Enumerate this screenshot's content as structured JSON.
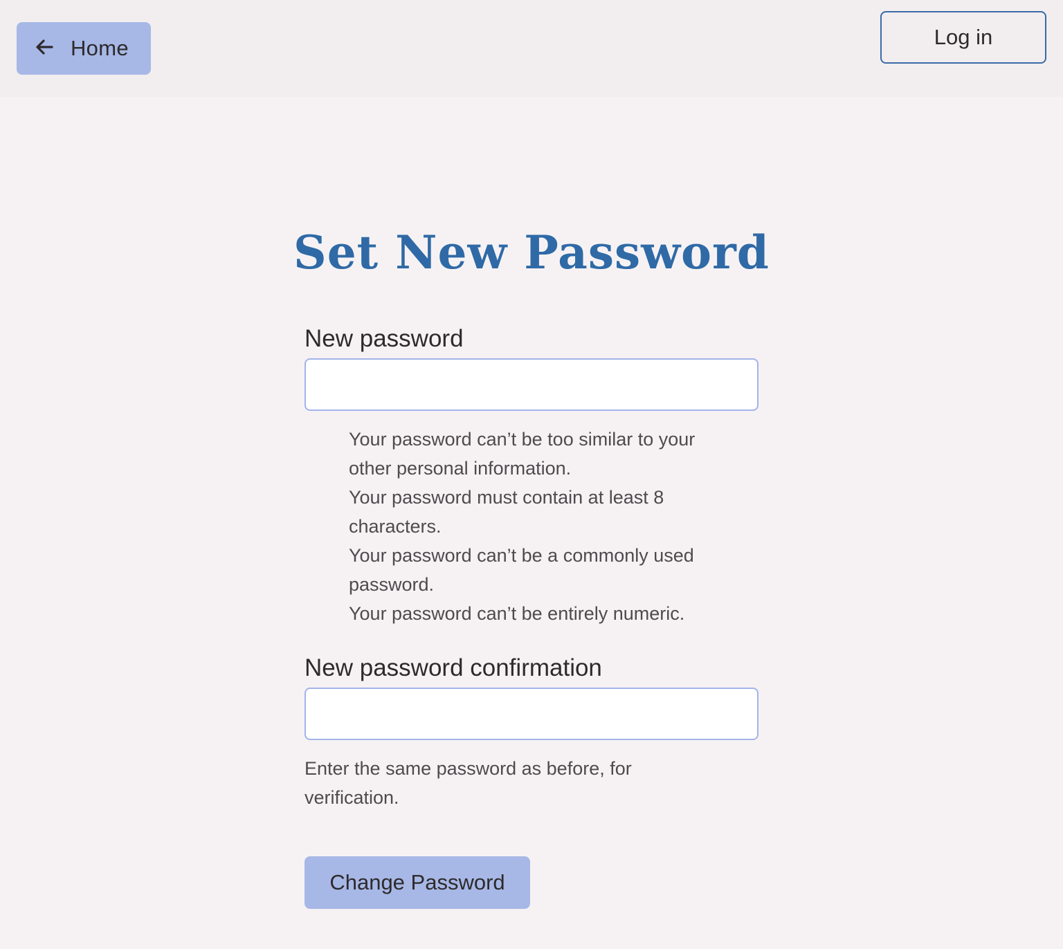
{
  "nav": {
    "home_label": "Home",
    "home_icon": "arrow-left-icon",
    "login_label": "Log in"
  },
  "page": {
    "title": "Set New Password"
  },
  "form": {
    "new_password": {
      "label": "New password",
      "value": "",
      "help": [
        "Your password can’t be too similar to your other personal information.",
        "Your password must contain at least 8 characters.",
        "Your password can’t be a commonly used password.",
        "Your password can’t be entirely numeric."
      ]
    },
    "confirm_password": {
      "label": "New password confirmation",
      "value": "",
      "help": "Enter the same password as before, for verification."
    },
    "submit_label": "Change Password"
  },
  "colors": {
    "accent": "#a7b8e6",
    "title": "#2f6aa6",
    "login_border": "#3a6aa6",
    "background": "#f6f2f4",
    "topbar": "#f2edef"
  }
}
